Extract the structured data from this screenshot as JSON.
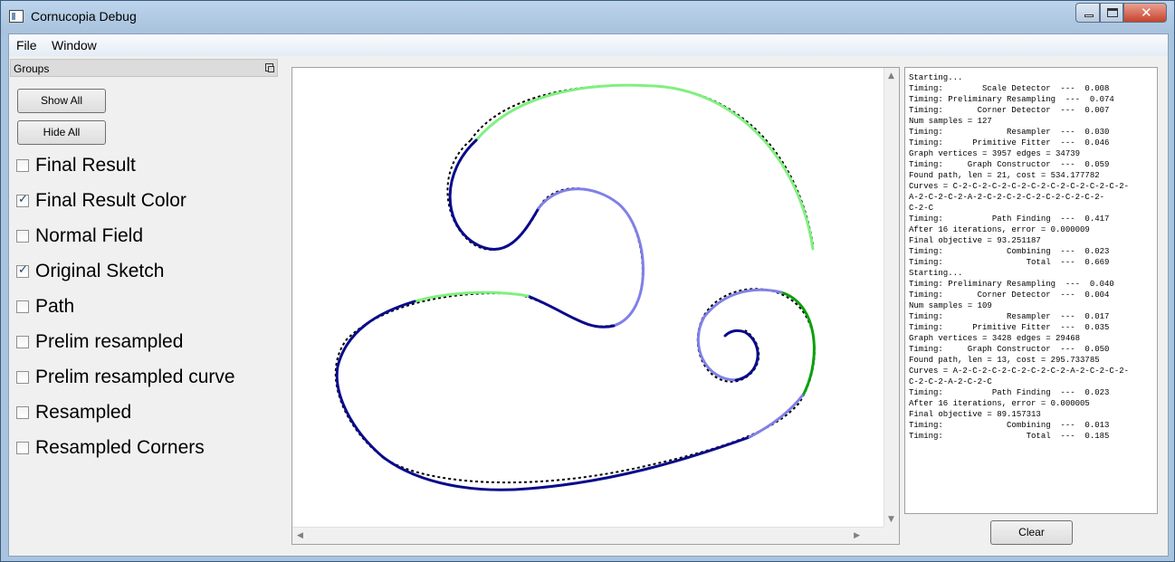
{
  "window": {
    "title": "Cornucopia Debug"
  },
  "menu": {
    "file": "File",
    "window": "Window"
  },
  "groups_panel": {
    "title": "Groups",
    "show_all": "Show All",
    "hide_all": "Hide All",
    "options": [
      {
        "label": "Final Result",
        "checked": false
      },
      {
        "label": "Final Result Color",
        "checked": true
      },
      {
        "label": "Normal Field",
        "checked": false
      },
      {
        "label": "Original Sketch",
        "checked": true
      },
      {
        "label": "Path",
        "checked": false
      },
      {
        "label": "Prelim resampled",
        "checked": false
      },
      {
        "label": "Prelim resampled curve",
        "checked": false
      },
      {
        "label": "Resampled",
        "checked": false
      },
      {
        "label": "Resampled Corners",
        "checked": false
      }
    ]
  },
  "colors": {
    "dark_blue": "#0a0a8c",
    "light_blue": "#8080e8",
    "light_green": "#80f080",
    "dark_green": "#0aa00a",
    "sketch": "#000000"
  },
  "log": {
    "lines": [
      "Starting...",
      "Timing:        Scale Detector  ---  0.008",
      "Timing: Preliminary Resampling  ---  0.074",
      "Timing:       Corner Detector  ---  0.007",
      "Num samples = 127",
      "Timing:             Resampler  ---  0.030",
      "Timing:      Primitive Fitter  ---  0.046",
      "Graph vertices = 3957 edges = 34739",
      "Timing:     Graph Constructor  ---  0.059",
      "Found path, len = 21, cost = 534.177782",
      "Curves = C-2-C-2-C-2-C-2-C-2-C-2-C-2-C-2-C-2-",
      "A-2-C-2-C-2-A-2-C-2-C-2-C-2-C-2-C-2-C-2-",
      "C-2-C",
      "Timing:          Path Finding  ---  0.417",
      "After 16 iterations, error = 0.000009",
      "Final objective = 93.251187",
      "Timing:             Combining  ---  0.023",
      "Timing:                 Total  ---  0.669",
      "Starting...",
      "Timing: Preliminary Resampling  ---  0.040",
      "Timing:       Corner Detector  ---  0.004",
      "Num samples = 109",
      "Timing:             Resampler  ---  0.017",
      "Timing:      Primitive Fitter  ---  0.035",
      "Graph vertices = 3428 edges = 29468",
      "Timing:     Graph Constructor  ---  0.050",
      "Found path, len = 13, cost = 295.733785",
      "Curves = A-2-C-2-C-2-C-2-C-2-C-2-A-2-C-2-C-2-",
      "C-2-C-2-A-2-C-2-C",
      "Timing:          Path Finding  ---  0.023",
      "After 16 iterations, error = 0.000005",
      "Final objective = 89.157313",
      "Timing:             Combining  ---  0.013",
      "Timing:                 Total  ---  0.185"
    ],
    "clear_button": "Clear"
  }
}
